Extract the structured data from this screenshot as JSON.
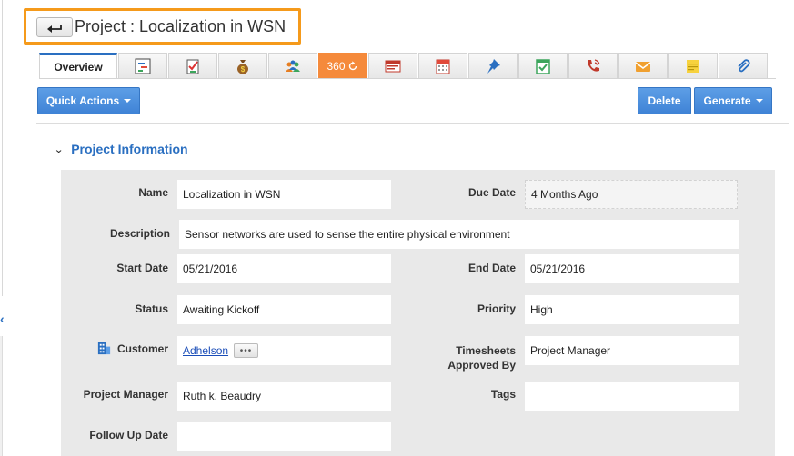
{
  "header": {
    "title": "Project : Localization in WSN"
  },
  "tabs": {
    "overview": "Overview",
    "three_sixty": "360",
    "icons": [
      "gantt-icon",
      "tasks-icon",
      "money-bag-icon",
      "team-icon",
      "360-icon",
      "invoice-icon",
      "calendar-icon",
      "pin-icon",
      "checklist-icon",
      "phone-icon",
      "email-icon",
      "note-icon",
      "attachment-icon"
    ]
  },
  "toolbar": {
    "quick_actions": "Quick Actions",
    "delete": "Delete",
    "generate": "Generate"
  },
  "section": {
    "title": "Project Information"
  },
  "fields": {
    "name_label": "Name",
    "name_value": "Localization in WSN",
    "due_date_label": "Due Date",
    "due_date_value": "4 Months Ago",
    "description_label": "Description",
    "description_value": "Sensor networks are used to sense the entire physical environment",
    "start_date_label": "Start Date",
    "start_date_value": "05/21/2016",
    "end_date_label": "End Date",
    "end_date_value": "05/21/2016",
    "status_label": "Status",
    "status_value": "Awaiting Kickoff",
    "priority_label": "Priority",
    "priority_value": "High",
    "customer_label": "Customer",
    "customer_value": "Adhelson",
    "timesheets_label_1": "Timesheets",
    "timesheets_label_2": "Approved By",
    "timesheets_value": "Project Manager",
    "project_manager_label": "Project Manager",
    "project_manager_value": "Ruth k. Beaudry",
    "tags_label": "Tags",
    "tags_value": "",
    "follow_up_label": "Follow Up Date",
    "follow_up_value": ""
  },
  "more_button": "•••",
  "colors": {
    "accent": "#2a6fc1",
    "highlight": "#f59a1b",
    "button": "#4a8ddc",
    "panel": "#e9e9e9"
  }
}
